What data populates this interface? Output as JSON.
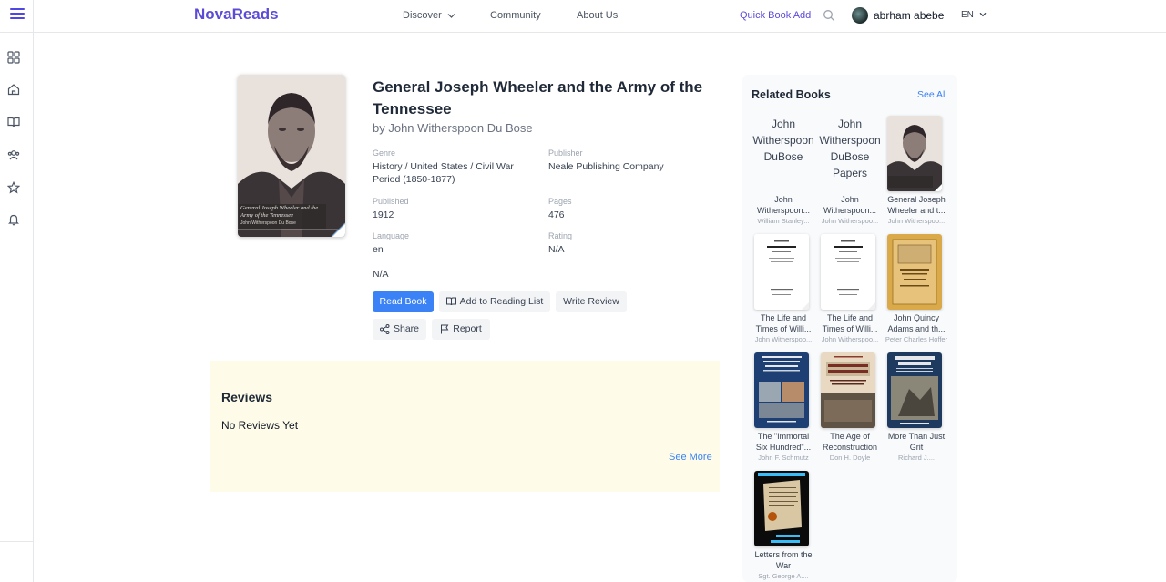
{
  "header": {
    "logo": "NovaReads",
    "nav": {
      "discover": "Discover",
      "community": "Community",
      "about": "About Us"
    },
    "quick_add": "Quick Book Add",
    "username": "abrham abebe",
    "language": "EN"
  },
  "sidebar": {
    "items": [
      {
        "icon": "grid-icon"
      },
      {
        "icon": "home-icon"
      },
      {
        "icon": "book-open-icon"
      },
      {
        "icon": "users-icon"
      },
      {
        "icon": "star-icon"
      },
      {
        "icon": "bell-icon"
      }
    ]
  },
  "book": {
    "title": "General Joseph Wheeler and the Army of the Tennessee",
    "author": "by John Witherspoon Du Bose",
    "cover_text": "General Joseph Wheeler and the Army of the Tennessee",
    "cover_author": "John Witherspoon Du Bose",
    "genre_label": "Genre",
    "genre": "History / United States / Civil War Period (1850-1877)",
    "publisher_label": "Publisher",
    "publisher": "Neale Publishing Company",
    "published_label": "Published",
    "published": "1912",
    "pages_label": "Pages",
    "pages": "476",
    "language_label": "Language",
    "language": "en",
    "rating_label": "Rating",
    "rating": "N/A",
    "extra": "N/A"
  },
  "actions": {
    "read": "Read Book",
    "add_list": "Add to Reading List",
    "write_review": "Write Review",
    "share": "Share",
    "report": "Report"
  },
  "reviews": {
    "title": "Reviews",
    "empty": "No Reviews Yet",
    "see_more": "See More"
  },
  "related": {
    "title": "Related Books",
    "see_all": "See All",
    "books": [
      {
        "alt": "John Witherspoon DuBose",
        "title": "John Witherspoon...",
        "author": "William Stanley..."
      },
      {
        "alt": "John Witherspoon DuBose Papers",
        "title": "John Witherspoon...",
        "author": "John Witherspoo..."
      },
      {
        "title": "General Joseph Wheeler and t...",
        "author": "John Witherspoo..."
      },
      {
        "title": "The Life and Times of Willi...",
        "author": "John Witherspoo..."
      },
      {
        "title": "The Life and Times of Willi...",
        "author": "John Witherspoo..."
      },
      {
        "title": "John Quincy Adams and th...",
        "author": "Peter Charles Hoffer"
      },
      {
        "title": "The \"Immortal Six Hundred\"...",
        "author": "John F. Schmutz"
      },
      {
        "title": "The Age of Reconstruction",
        "author": "Don H. Doyle"
      },
      {
        "title": "More Than Just Grit",
        "author": "Richard J...."
      },
      {
        "title": "Letters from the War",
        "author": "Sgt. George A...."
      }
    ]
  },
  "colors": {
    "brand": "#5b4bd6",
    "primary_button": "#3b82f6",
    "reviews_bg": "#fefce8"
  }
}
